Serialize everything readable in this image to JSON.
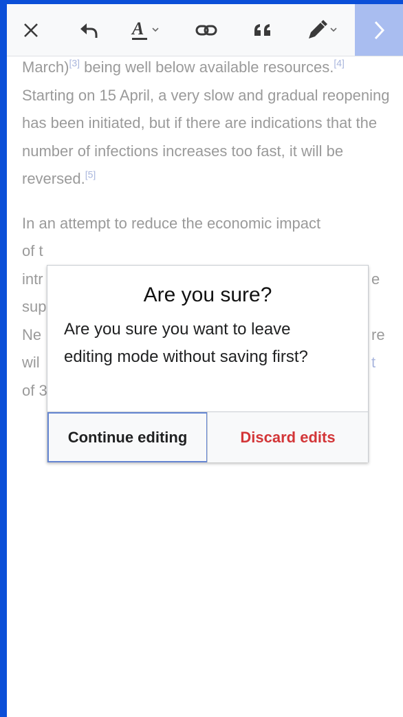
{
  "toolbar": {
    "icons": [
      "close-icon",
      "undo-icon",
      "text-style-icon",
      "link-icon",
      "quote-icon",
      "insert-icon",
      "next-icon"
    ],
    "next_bg": "#a9bdf0"
  },
  "article": {
    "p1": {
      "t1": "March)",
      "r1": "[3]",
      "t2": " being well below available resources.",
      "r2": "[4]",
      "t3": " Starting on 15 April, a very slow and gradual reopening has been initiated, but if there are indications that the number of infections increases too fast, it will be reversed.",
      "r3": "[5]"
    },
    "p2": {
      "line1": "In an attempt to reduce the economic impact",
      "line2": "of t",
      "line3": "intr",
      "line3_right": "e",
      "line4": "sup",
      "line5": "Ne",
      "line5_right": "re",
      "line6": "wil",
      "line6_right": "t",
      "line7": "of 3"
    }
  },
  "dialog": {
    "title": "Are you sure?",
    "message": "Are you sure you want to leave editing mode without saving first?",
    "continue_label": "Continue editing",
    "discard_label": "Discard edits",
    "discard_color": "#d33638",
    "focus_color": "#6485d1"
  },
  "colors": {
    "frame_border": "#0b4fd8"
  }
}
